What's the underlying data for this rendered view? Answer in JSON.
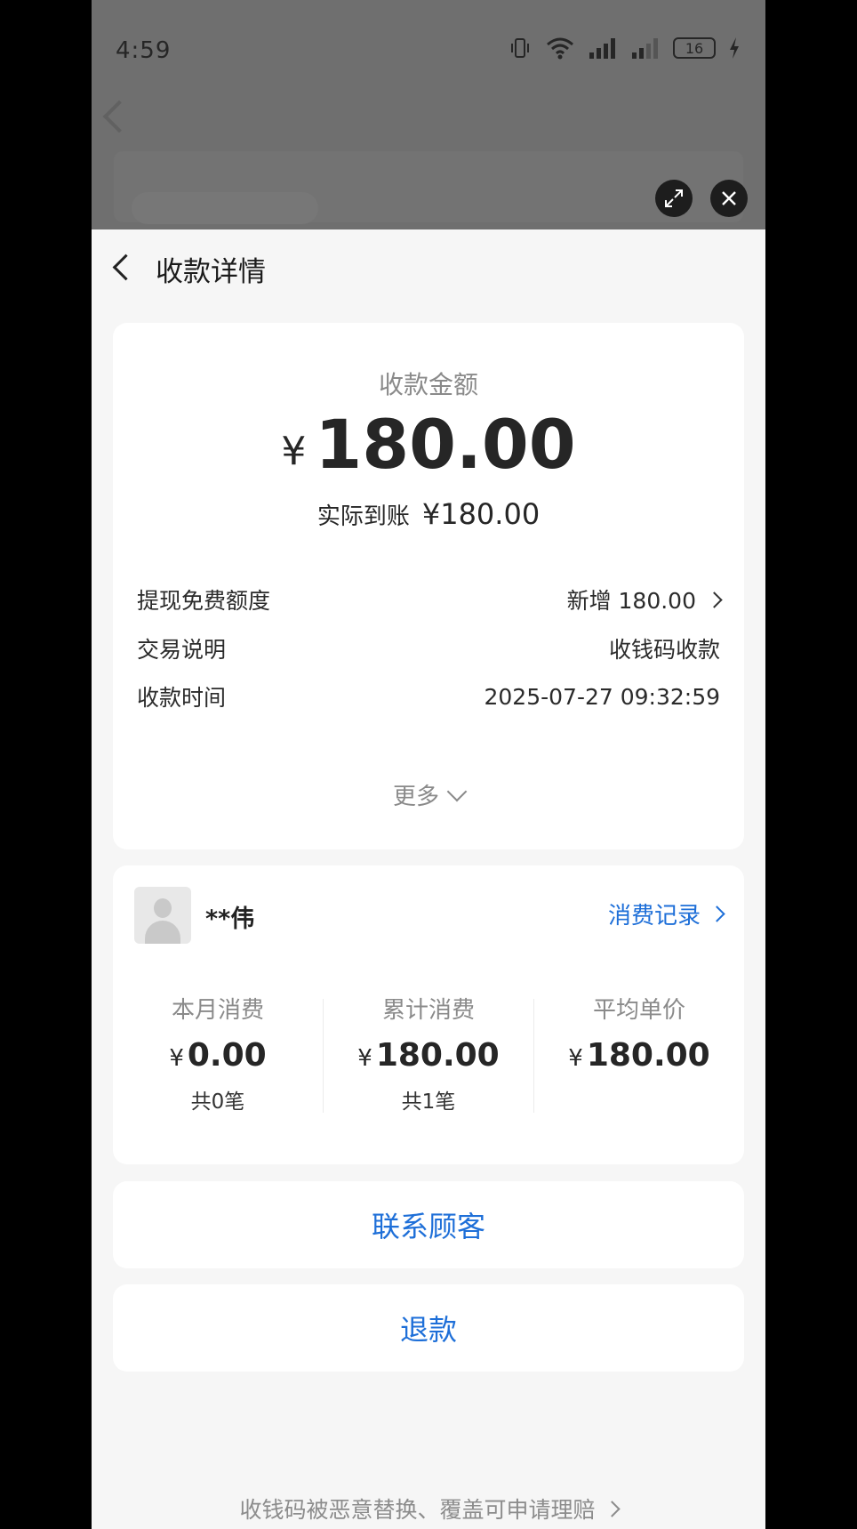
{
  "status_bar": {
    "time": "4:59",
    "battery": "16"
  },
  "header": {
    "title": "收款详情"
  },
  "amount_card": {
    "label": "收款金额",
    "currency": "¥",
    "amount": "180.00",
    "actual_label": "实际到账",
    "actual_value": "¥180.00",
    "rows": [
      {
        "label": "提现免费额度",
        "value": "新增 180.00"
      },
      {
        "label": "交易说明",
        "value": "收钱码收款"
      },
      {
        "label": "收款时间",
        "value": "2025-07-27 09:32:59"
      }
    ],
    "more_label": "更多"
  },
  "customer_card": {
    "name": "**伟",
    "records_link": "消费记录",
    "stats": [
      {
        "label": "本月消费",
        "currency": "¥",
        "value": "0.00",
        "count": "共0笔"
      },
      {
        "label": "累计消费",
        "currency": "¥",
        "value": "180.00",
        "count": "共1笔"
      },
      {
        "label": "平均单价",
        "currency": "¥",
        "value": "180.00",
        "count": ""
      }
    ]
  },
  "actions": {
    "contact": "联系顾客",
    "refund": "退款"
  },
  "footer": {
    "link": "收钱码被恶意替换、覆盖可申请理赔"
  },
  "colors": {
    "accent": "#1e6fd8",
    "background": "#f6f6f6",
    "card": "#ffffff"
  }
}
